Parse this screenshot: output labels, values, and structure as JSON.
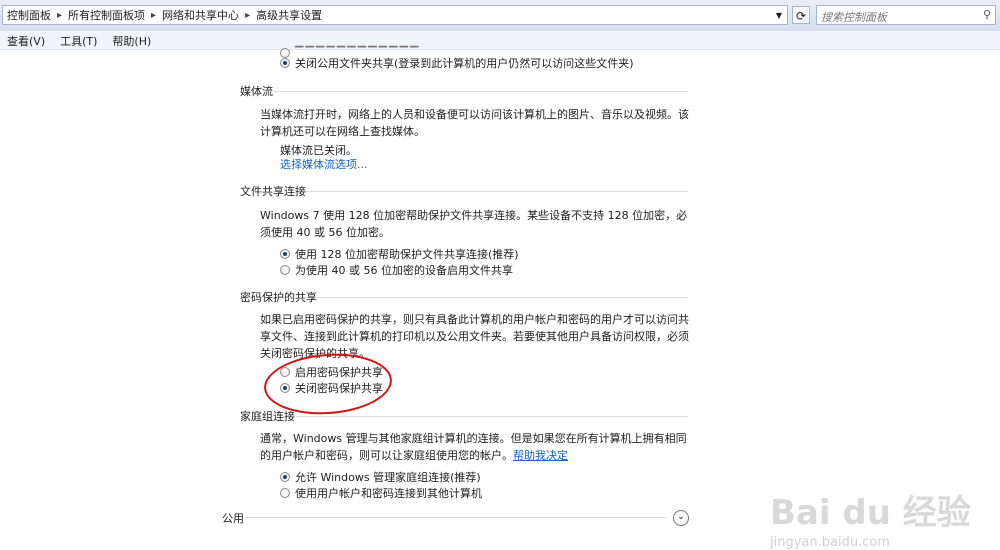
{
  "breadcrumb": [
    "控制面板",
    "所有控制面板项",
    "网络和共享中心",
    "高级共享设置"
  ],
  "search": {
    "placeholder": "搜索控制面板"
  },
  "menubar": [
    "查看(V)",
    "工具(T)",
    "帮助(H)"
  ],
  "top_option": "关闭公用文件夹共享(登录到此计算机的用户仍然可以访问这些文件夹)",
  "media": {
    "title": "媒体流",
    "desc": "当媒体流打开时，网络上的人员和设备便可以访问该计算机上的图片、音乐以及视频。该计算机还可以在网络上查找媒体。",
    "status": "媒体流已关闭。",
    "link": "选择媒体流选项..."
  },
  "file_sharing": {
    "title": "文件共享连接",
    "desc": "Windows 7 使用 128 位加密帮助保护文件共享连接。某些设备不支持 128 位加密，必须使用 40 或 56 位加密。",
    "options": [
      "使用 128 位加密帮助保护文件共享连接(推荐)",
      "为使用 40 或 56 位加密的设备启用文件共享"
    ]
  },
  "password": {
    "title": "密码保护的共享",
    "desc": "如果已启用密码保护的共享，则只有具备此计算机的用户帐户和密码的用户才可以访问共享文件、连接到此计算机的打印机以及公用文件夹。若要使其他用户具备访问权限，必须关闭密码保护的共享。",
    "options": [
      "启用密码保护共享",
      "关闭密码保护共享"
    ]
  },
  "homegroup": {
    "title": "家庭组连接",
    "desc": "通常，Windows 管理与其他家庭组计算机的连接。但是如果您在所有计算机上拥有相同的用户帐户和密码，则可以让家庭组使用您的帐户。",
    "help_link": "帮助我决定",
    "options": [
      "允许 Windows 管理家庭组连接(推荐)",
      "使用用户帐户和密码连接到其他计算机"
    ]
  },
  "public": {
    "title": "公用"
  },
  "watermark": {
    "main": "Bai du 经验",
    "sub": "jingyan.baidu.com"
  },
  "colors": {
    "link": "#1565c0",
    "annotation": "#d21414"
  }
}
